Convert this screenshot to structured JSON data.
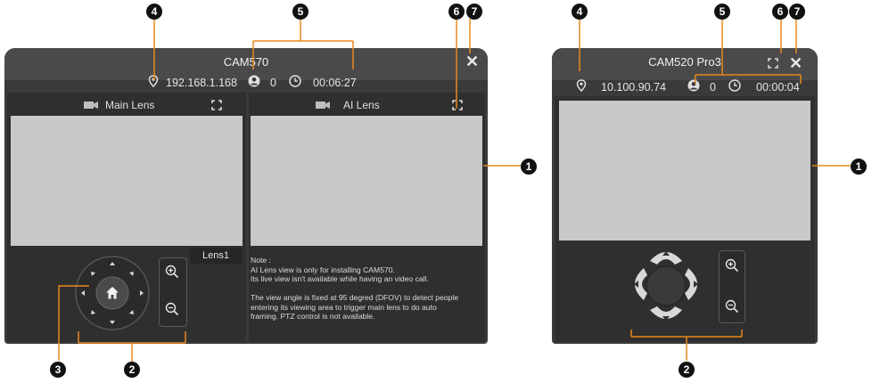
{
  "left_window": {
    "title": "CAM570",
    "ip": "192.168.1.168",
    "viewers": "0",
    "duration": "00:06:27",
    "main_lens_label": "Main Lens",
    "ai_lens_label": "AI Lens",
    "lens_tab": "Lens1",
    "note": "Note :\nAI Lens view is only for installing CAM570.\nIts live view isn't available while having an video call.\n\nThe view angle is fixed at 95 degred (DFOV) to detect people\nentering its viewing area to trigger main lens to do auto\nframing. PTZ control is not available."
  },
  "right_window": {
    "title": "CAM520 Pro3",
    "ip": "10.100.90.74",
    "viewers": "0",
    "duration": "00:00:04"
  },
  "callouts": {
    "c1": "1",
    "c2": "2",
    "c3": "3",
    "c4": "4",
    "c5": "5",
    "c6": "6",
    "c7": "7"
  },
  "colors": {
    "callout_line": "#e8891c",
    "window_bg": "#3a3a3a",
    "video_bg": "#c8c8c8"
  }
}
